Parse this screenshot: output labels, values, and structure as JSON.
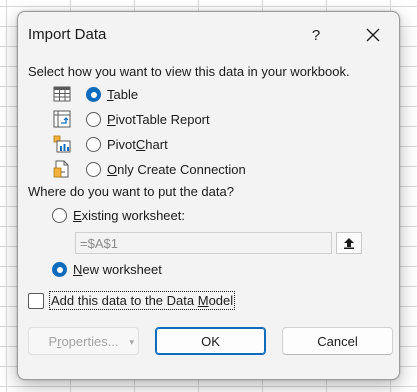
{
  "dialog": {
    "title": "Import Data",
    "help_label": "?",
    "close_label": "close"
  },
  "view_section": {
    "heading": "Select how you want to view this data in your workbook.",
    "options": [
      {
        "pre": "",
        "u": "T",
        "post": "able",
        "checked": true,
        "icon": "table-icon"
      },
      {
        "pre": "",
        "u": "P",
        "post": "ivotTable Report",
        "checked": false,
        "icon": "pivottable-icon"
      },
      {
        "pre": "Pivot",
        "u": "C",
        "post": "hart",
        "checked": false,
        "icon": "pivotchart-icon"
      },
      {
        "pre": "",
        "u": "O",
        "post": "nly Create Connection",
        "checked": false,
        "icon": "connection-icon"
      }
    ]
  },
  "location_section": {
    "heading": "Where do you want to put the data?",
    "existing": {
      "pre": "",
      "u": "E",
      "post": "xisting worksheet:",
      "checked": false
    },
    "reference_value": "=$A$1",
    "new": {
      "pre": "",
      "u": "N",
      "post": "ew worksheet",
      "checked": true
    }
  },
  "data_model": {
    "pre": "Add this data to the Data ",
    "u": "M",
    "post": "odel",
    "checked": false
  },
  "buttons": {
    "properties_pre": "P",
    "properties_u": "r",
    "properties_post": "operties...",
    "ok": "OK",
    "cancel": "Cancel"
  },
  "colors": {
    "accent": "#0f6cbd",
    "dialog_bg": "#f3f3f3",
    "disabled_text": "#a3a3a3"
  }
}
